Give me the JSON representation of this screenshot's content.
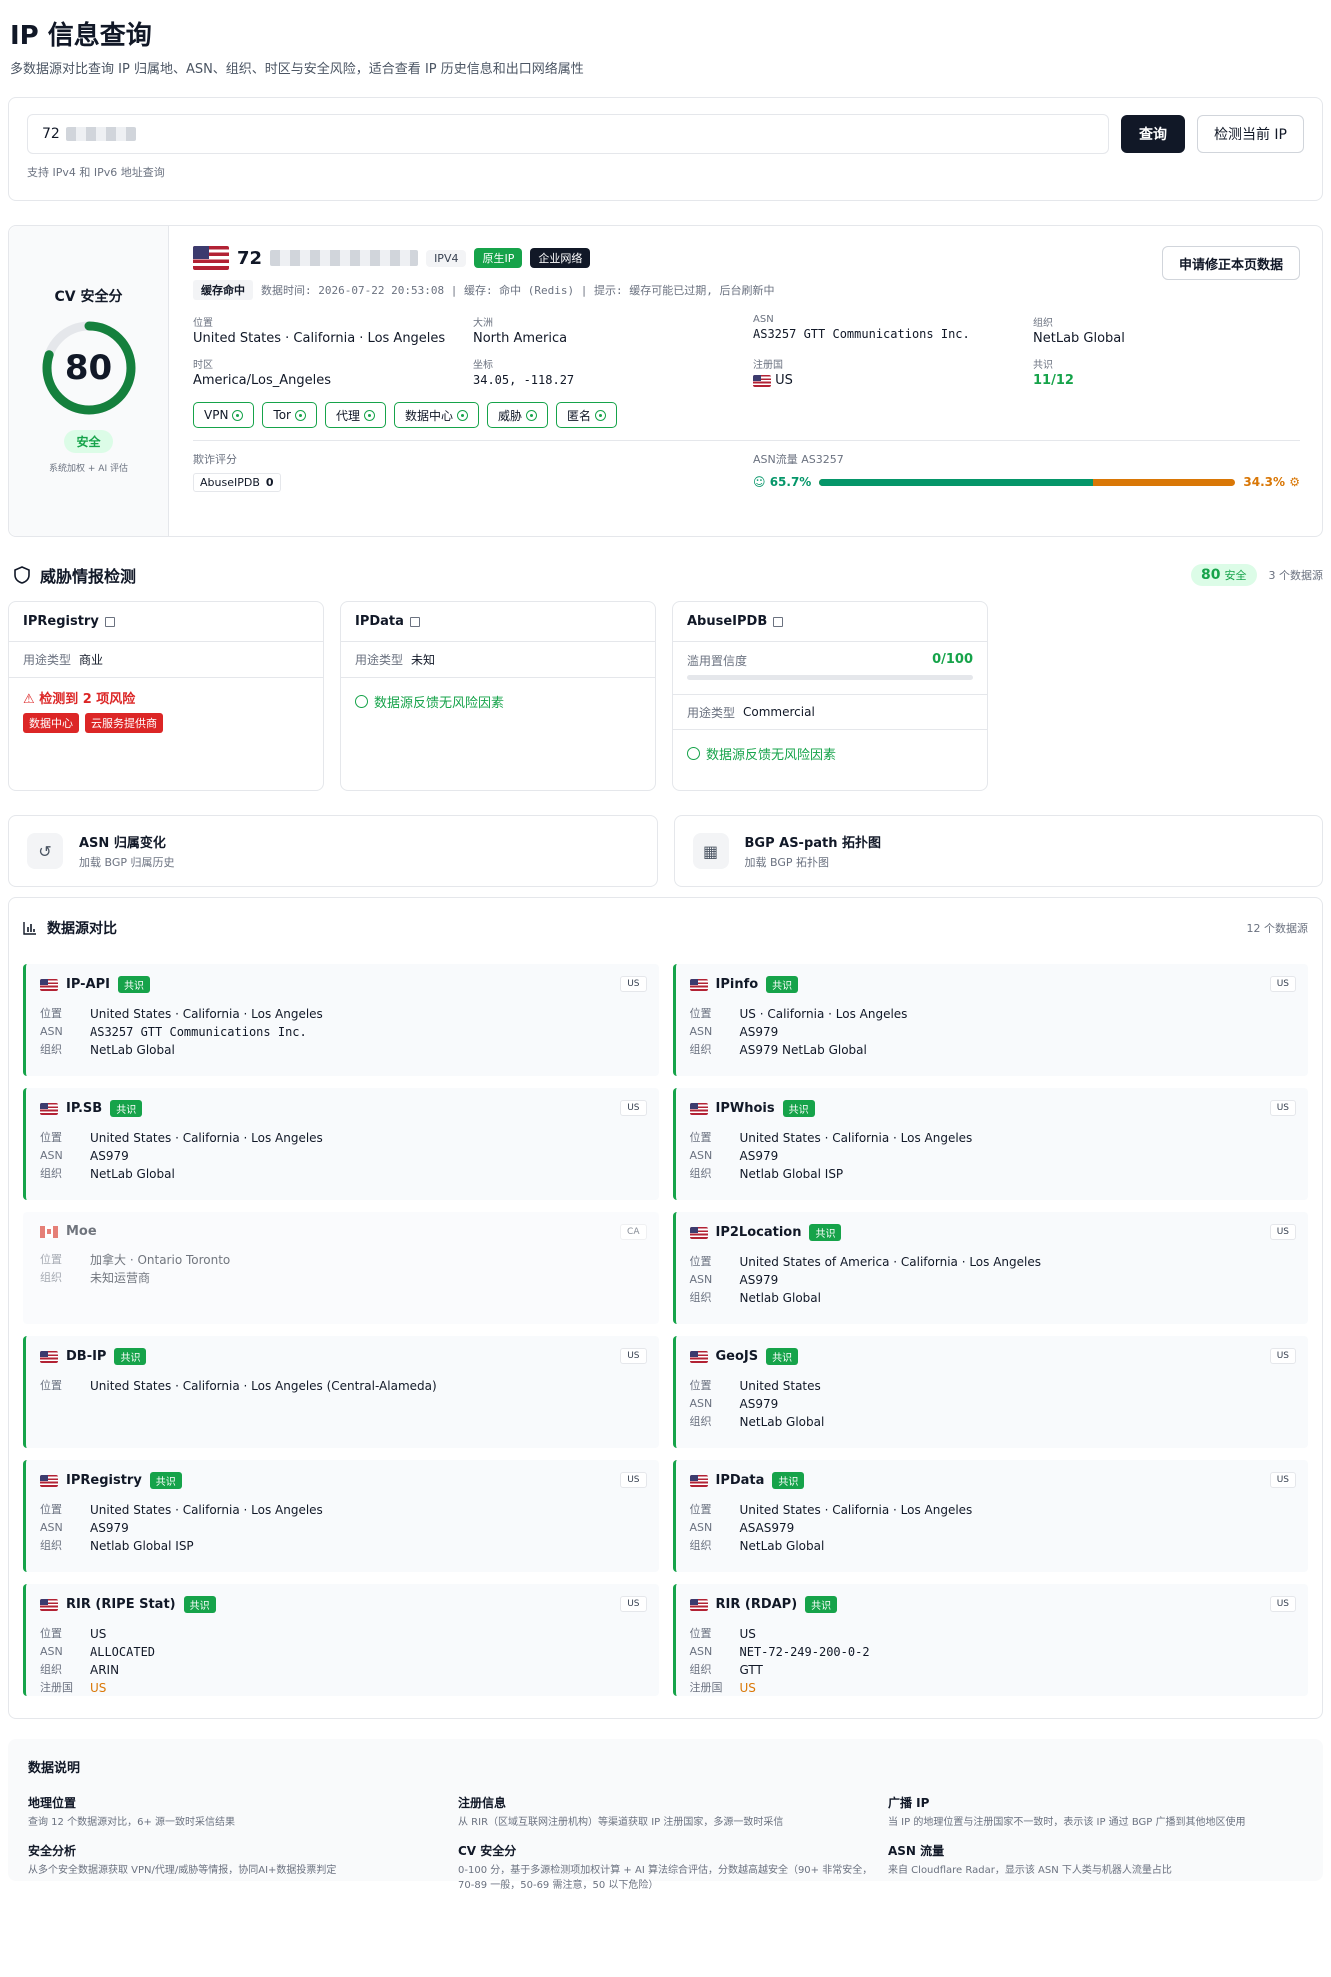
{
  "header": {
    "title": "IP 信息查询",
    "subtitle": "多数据源对比查询 IP 归属地、ASN、组织、时区与安全风险，适合查看 IP 历史信息和出口网络属性"
  },
  "search": {
    "value_prefix": "72",
    "query_label": "查询",
    "detect_label": "检测当前 IP",
    "hint": "支持 IPv4 和 IPv6 地址查询"
  },
  "score": {
    "title": "CV 安全分",
    "value": "80",
    "value_num": 80,
    "status": "安全",
    "note": "系统加权 + AI 评估",
    "color": "#15803d"
  },
  "overview": {
    "ip_prefix": "72",
    "ip_version": "IPV4",
    "tag_native": "原生IP",
    "tag_enterprise": "企业网络",
    "correct_label": "申请修正本页数据",
    "cache_badge": "缓存命中",
    "cache_text": "数据时间: 2026-07-22 20:53:08 | 缓存: 命中 (Redis) | 提示: 缓存可能已过期, 后台刷新中",
    "location_label": "位置",
    "location": "United States · California · Los Angeles",
    "continent_label": "大洲",
    "continent": "North America",
    "asn_label": "ASN",
    "asn": "AS3257 GTT Communications Inc.",
    "org_label": "组织",
    "org": "NetLab Global",
    "timezone_label": "时区",
    "timezone": "America/Los_Angeles",
    "coords_label": "坐标",
    "coords": "34.05, -118.27",
    "reg_label": "注册国",
    "reg": "US",
    "consensus_label": "共识",
    "consensus": "11/12",
    "flags": [
      "VPN",
      "Tor",
      "代理",
      "数据中心",
      "威胁",
      "匿名"
    ],
    "fraud_label": "欺诈评分",
    "abuse_name": "AbuseIPDB",
    "abuse_value": "0",
    "asn_flow_label": "ASN流量 AS3257",
    "human_pct": "65.7%",
    "bot_pct": "34.3%",
    "human_frac": 0.657
  },
  "threat": {
    "title": "威胁情报检测",
    "score": "80",
    "score_status": "安全",
    "source_count": "3 个数据源",
    "ipregistry": {
      "name": "IPRegistry",
      "usage_label": "用途类型",
      "usage": "商业",
      "risk": "检测到 2 项风险",
      "tags": [
        "数据中心",
        "云服务提供商"
      ]
    },
    "ipdata": {
      "name": "IPData",
      "usage_label": "用途类型",
      "usage": "未知",
      "ok": "数据源反馈无风险因素"
    },
    "abuseipdb": {
      "name": "AbuseIPDB",
      "conf_label": "滥用置信度",
      "conf": "0/100",
      "conf_frac": 0,
      "usage_label": "用途类型",
      "usage": "Commercial",
      "ok": "数据源反馈无风险因素"
    }
  },
  "history": {
    "asn_title": "ASN 归属变化",
    "asn_sub": "加载 BGP 归属历史",
    "bgp_title": "BGP AS-path 拓扑图",
    "bgp_sub": "加载 BGP 拓扑图"
  },
  "compare": {
    "title": "数据源对比",
    "count": "12 个数据源",
    "consensus_label": "共识",
    "sources": [
      {
        "name": "IP-API",
        "flag": "us",
        "cc": "US",
        "consensus": true,
        "rows": [
          [
            "位置",
            "United States · California · Los Angeles",
            ""
          ],
          [
            "ASN",
            "AS3257 GTT Communications Inc.",
            "mono"
          ],
          [
            "组织",
            "NetLab Global",
            ""
          ]
        ]
      },
      {
        "name": "IPinfo",
        "flag": "us",
        "cc": "US",
        "consensus": true,
        "rows": [
          [
            "位置",
            "US · California · Los Angeles",
            ""
          ],
          [
            "ASN",
            "AS979",
            ""
          ],
          [
            "组织",
            "AS979 NetLab Global",
            ""
          ]
        ]
      },
      {
        "name": "IP.SB",
        "flag": "us",
        "cc": "US",
        "consensus": true,
        "rows": [
          [
            "位置",
            "United States · California · Los Angeles",
            ""
          ],
          [
            "ASN",
            "AS979",
            ""
          ],
          [
            "组织",
            "NetLab Global",
            ""
          ]
        ]
      },
      {
        "name": "IPWhois",
        "flag": "us",
        "cc": "US",
        "consensus": true,
        "rows": [
          [
            "位置",
            "United States · California · Los Angeles",
            ""
          ],
          [
            "ASN",
            "AS979",
            ""
          ],
          [
            "组织",
            "Netlab Global ISP",
            ""
          ]
        ]
      },
      {
        "name": "Moe",
        "flag": "ca",
        "cc": "CA",
        "consensus": false,
        "rows": [
          [
            "位置",
            "加拿大 · Ontario Toronto",
            ""
          ],
          [
            "组织",
            "未知运营商",
            ""
          ]
        ]
      },
      {
        "name": "IP2Location",
        "flag": "us",
        "cc": "US",
        "consensus": true,
        "rows": [
          [
            "位置",
            "United States of America · California · Los Angeles",
            ""
          ],
          [
            "ASN",
            "AS979",
            ""
          ],
          [
            "组织",
            "Netlab Global",
            ""
          ]
        ]
      },
      {
        "name": "DB-IP",
        "flag": "us",
        "cc": "US",
        "consensus": true,
        "rows": [
          [
            "位置",
            "United States · California · Los Angeles (Central-Alameda)",
            ""
          ]
        ]
      },
      {
        "name": "GeoJS",
        "flag": "us",
        "cc": "US",
        "consensus": true,
        "rows": [
          [
            "位置",
            "United States",
            ""
          ],
          [
            "ASN",
            "AS979",
            ""
          ],
          [
            "组织",
            "NetLab Global",
            ""
          ]
        ]
      },
      {
        "name": "IPRegistry",
        "flag": "us",
        "cc": "US",
        "consensus": true,
        "rows": [
          [
            "位置",
            "United States · California · Los Angeles",
            ""
          ],
          [
            "ASN",
            "AS979",
            ""
          ],
          [
            "组织",
            "Netlab Global ISP",
            ""
          ]
        ]
      },
      {
        "name": "IPData",
        "flag": "us",
        "cc": "US",
        "consensus": true,
        "rows": [
          [
            "位置",
            "United States · California · Los Angeles",
            ""
          ],
          [
            "ASN",
            "ASAS979",
            ""
          ],
          [
            "组织",
            "NetLab Global",
            ""
          ]
        ]
      },
      {
        "name": "RIR (RIPE Stat)",
        "flag": "us",
        "cc": "US",
        "consensus": true,
        "rows": [
          [
            "位置",
            "US",
            ""
          ],
          [
            "ASN",
            "ALLOCATED",
            "mono"
          ],
          [
            "组织",
            "ARIN",
            ""
          ],
          [
            "注册国",
            "US",
            "orange"
          ]
        ]
      },
      {
        "name": "RIR (RDAP)",
        "flag": "us",
        "cc": "US",
        "consensus": true,
        "rows": [
          [
            "位置",
            "US",
            ""
          ],
          [
            "ASN",
            "NET-72-249-200-0-2",
            "mono"
          ],
          [
            "组织",
            "GTT",
            ""
          ],
          [
            "注册国",
            "US",
            "orange"
          ]
        ]
      }
    ]
  },
  "notes": {
    "title": "数据说明",
    "items": [
      {
        "h": "地理位置",
        "b": "查询 12 个数据源对比，6+ 源一致时采信结果"
      },
      {
        "h": "注册信息",
        "b": "从 RIR（区域互联网注册机构）等渠道获取 IP 注册国家，多源一致时采信"
      },
      {
        "h": "广播 IP",
        "b": "当 IP 的地理位置与注册国家不一致时，表示该 IP 通过 BGP 广播到其他地区使用"
      },
      {
        "h": "安全分析",
        "b": "从多个安全数据源获取 VPN/代理/威胁等情报，协同AI+数据投票判定"
      },
      {
        "h": "CV 安全分",
        "b": "0-100 分，基于多源检测项加权计算 + AI 算法综合评估，分数越高越安全（90+ 非常安全，70-89 一般，50-69 需注意，50 以下危险）"
      },
      {
        "h": "ASN 流量",
        "b": "来自 Cloudflare Radar，显示该 ASN 下人类与机器人流量占比"
      }
    ]
  }
}
